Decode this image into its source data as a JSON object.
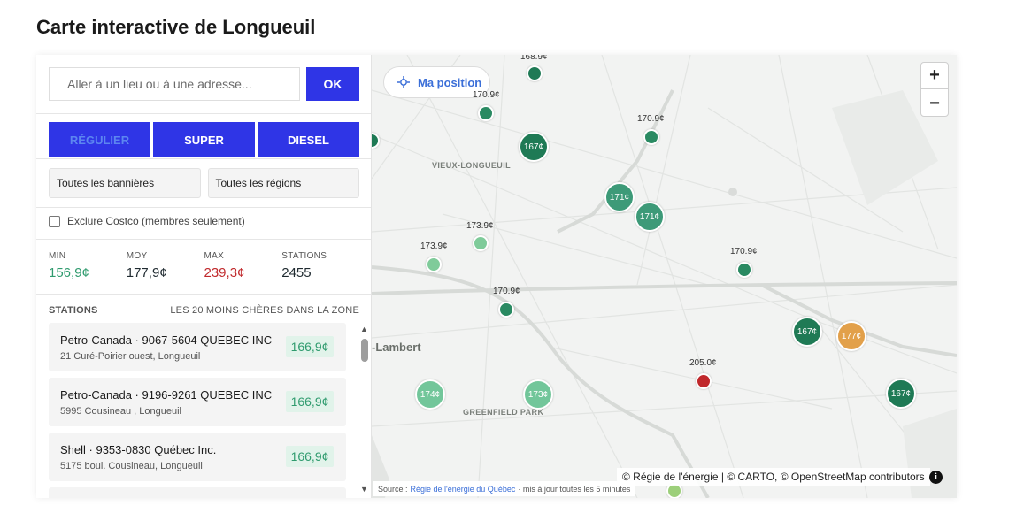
{
  "page": {
    "title": "Carte interactive de Longueuil"
  },
  "search": {
    "placeholder": "Aller à un lieu ou à une adresse...",
    "ok_label": "OK"
  },
  "fuel_tabs": [
    "RÉGULIER",
    "SUPER",
    "DIESEL"
  ],
  "active_fuel": "RÉGULIER",
  "filters": {
    "banners": "Toutes les bannières",
    "regions": "Toutes les régions"
  },
  "costco": {
    "label": "Exclure Costco (membres seulement)",
    "checked": false
  },
  "stats": {
    "min": {
      "label": "MIN",
      "value": "156,9¢"
    },
    "avg": {
      "label": "MOY",
      "value": "177,9¢"
    },
    "max": {
      "label": "MAX",
      "value": "239,3¢"
    },
    "stations": {
      "label": "STATIONS",
      "value": "2455"
    }
  },
  "stations_header": {
    "title": "STATIONS",
    "subtitle": "LES 20 MOINS CHÈRES DANS LA ZONE"
  },
  "stations": [
    {
      "name": "Petro-Canada · 9067-5604 QUEBEC INC",
      "address": "21 Curé-Poirier ouest, Longueuil",
      "price": "166,9¢"
    },
    {
      "name": "Petro-Canada · 9196-9261 QUEBEC INC",
      "address": "5995 Cousineau , Longueuil",
      "price": "166,9¢"
    },
    {
      "name": "Shell · 9353-0830 Québec Inc.",
      "address": "5175 boul. Cousineau, Longueuil",
      "price": "166,9¢"
    }
  ],
  "map": {
    "my_position_label": "Ma position",
    "zoom_in": "+",
    "zoom_out": "−",
    "labels": {
      "vieux_longueuil": "VIEUX-LONGUEUIL",
      "lambert": "-Lambert",
      "greenfield": "GREENFIELD PARK"
    },
    "markers": [
      {
        "label": "",
        "tag": "168.9¢",
        "color": "#1f7a55",
        "size": "small"
      },
      {
        "label": "",
        "tag": "170.9¢",
        "color": "#2a8a62",
        "size": "small"
      },
      {
        "label": "167¢",
        "tag": "",
        "color": "#1f7a55",
        "size": "big"
      },
      {
        "label": "",
        "tag": "170.9¢",
        "color": "#2a8a62",
        "size": "small"
      },
      {
        "label": "171¢",
        "tag": "",
        "color": "#3d9a78",
        "size": "big"
      },
      {
        "label": "171¢",
        "tag": "",
        "color": "#3d9a78",
        "size": "big"
      },
      {
        "label": "",
        "tag": "173.9¢",
        "color": "#7fcb9a",
        "size": "small"
      },
      {
        "label": "",
        "tag": "173.9¢",
        "color": "#7fcb9a",
        "size": "small"
      },
      {
        "label": "",
        "tag": "170.9¢",
        "color": "#2a8a62",
        "size": "small"
      },
      {
        "label": "",
        "tag": "170.9¢",
        "color": "#2a8a62",
        "size": "small"
      },
      {
        "label": "167¢",
        "tag": "",
        "color": "#1f7a55",
        "size": "big"
      },
      {
        "label": "177¢",
        "tag": "",
        "color": "#e2a04a",
        "size": "big"
      },
      {
        "label": "",
        "tag": "205.0¢",
        "color": "#c0282b",
        "size": "small"
      },
      {
        "label": "174¢",
        "tag": "",
        "color": "#72c69a",
        "size": "big"
      },
      {
        "label": "173¢",
        "tag": "",
        "color": "#72c69a",
        "size": "big"
      },
      {
        "label": "167¢",
        "tag": "",
        "color": "#1f7a55",
        "size": "big"
      }
    ],
    "attribution": "© Régie de l'énergie | © CARTO, © OpenStreetMap contributors",
    "info_icon": "i",
    "source": {
      "prefix": "Source :",
      "link": "Régie de l'énergie du Québec",
      "suffix": "· mis à jour toutes les 5 minutes"
    }
  }
}
